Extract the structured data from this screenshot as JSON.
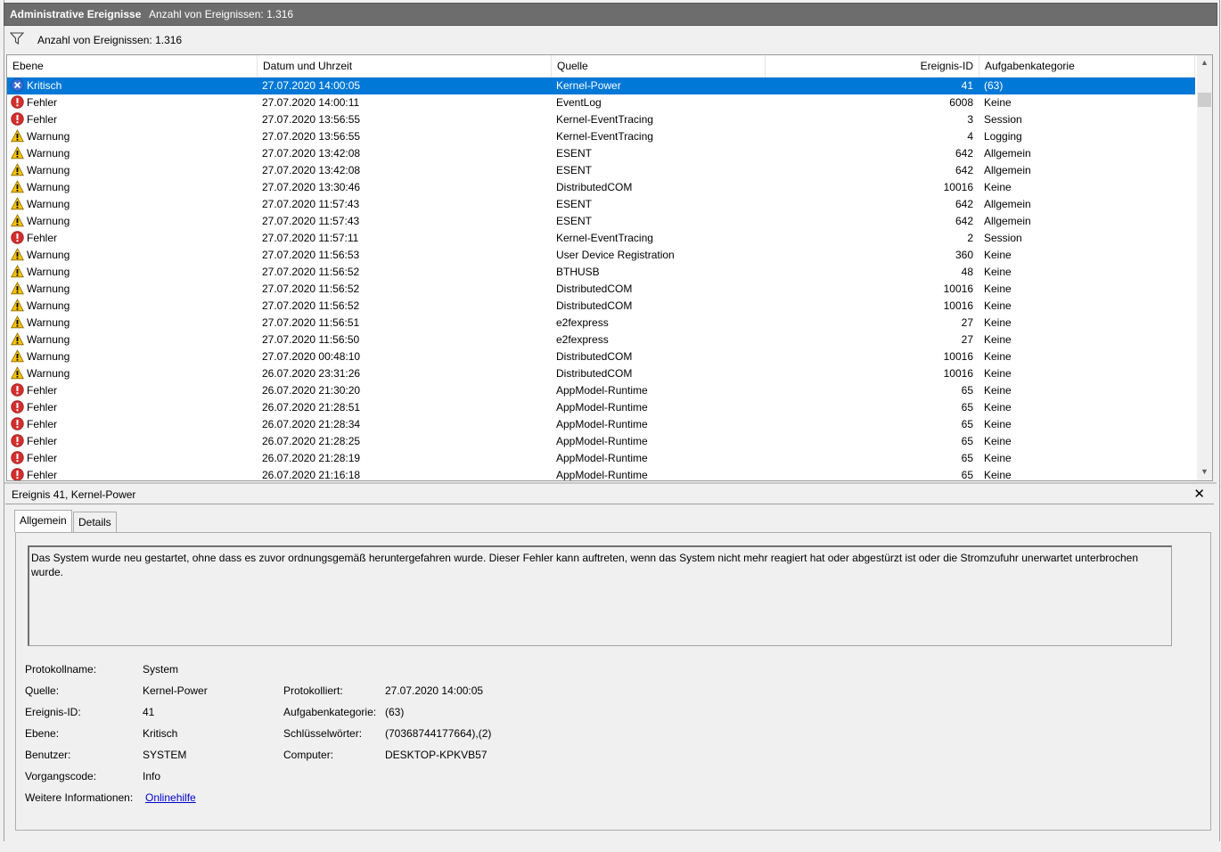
{
  "titlebar": {
    "title": "Administrative Ereignisse",
    "count": "Anzahl von Ereignissen: 1.316"
  },
  "filter": {
    "icon": "filter-icon",
    "text": "Anzahl von Ereignissen: 1.316"
  },
  "columns": {
    "level": "Ebene",
    "date": "Datum und Uhrzeit",
    "source": "Quelle",
    "id": "Ereignis-ID",
    "category": "Aufgabenkategorie"
  },
  "events": [
    {
      "level": "Kritisch",
      "type": "critical",
      "date": "27.07.2020 14:00:05",
      "source": "Kernel-Power",
      "id": "41",
      "category": "(63)"
    },
    {
      "level": "Fehler",
      "type": "error",
      "date": "27.07.2020 14:00:11",
      "source": "EventLog",
      "id": "6008",
      "category": "Keine"
    },
    {
      "level": "Fehler",
      "type": "error",
      "date": "27.07.2020 13:56:55",
      "source": "Kernel-EventTracing",
      "id": "3",
      "category": "Session"
    },
    {
      "level": "Warnung",
      "type": "warning",
      "date": "27.07.2020 13:56:55",
      "source": "Kernel-EventTracing",
      "id": "4",
      "category": "Logging"
    },
    {
      "level": "Warnung",
      "type": "warning",
      "date": "27.07.2020 13:42:08",
      "source": "ESENT",
      "id": "642",
      "category": "Allgemein"
    },
    {
      "level": "Warnung",
      "type": "warning",
      "date": "27.07.2020 13:42:08",
      "source": "ESENT",
      "id": "642",
      "category": "Allgemein"
    },
    {
      "level": "Warnung",
      "type": "warning",
      "date": "27.07.2020 13:30:46",
      "source": "DistributedCOM",
      "id": "10016",
      "category": "Keine"
    },
    {
      "level": "Warnung",
      "type": "warning",
      "date": "27.07.2020 11:57:43",
      "source": "ESENT",
      "id": "642",
      "category": "Allgemein"
    },
    {
      "level": "Warnung",
      "type": "warning",
      "date": "27.07.2020 11:57:43",
      "source": "ESENT",
      "id": "642",
      "category": "Allgemein"
    },
    {
      "level": "Fehler",
      "type": "error",
      "date": "27.07.2020 11:57:11",
      "source": "Kernel-EventTracing",
      "id": "2",
      "category": "Session"
    },
    {
      "level": "Warnung",
      "type": "warning",
      "date": "27.07.2020 11:56:53",
      "source": "User Device Registration",
      "id": "360",
      "category": "Keine"
    },
    {
      "level": "Warnung",
      "type": "warning",
      "date": "27.07.2020 11:56:52",
      "source": "BTHUSB",
      "id": "48",
      "category": "Keine"
    },
    {
      "level": "Warnung",
      "type": "warning",
      "date": "27.07.2020 11:56:52",
      "source": "DistributedCOM",
      "id": "10016",
      "category": "Keine"
    },
    {
      "level": "Warnung",
      "type": "warning",
      "date": "27.07.2020 11:56:52",
      "source": "DistributedCOM",
      "id": "10016",
      "category": "Keine"
    },
    {
      "level": "Warnung",
      "type": "warning",
      "date": "27.07.2020 11:56:51",
      "source": "e2fexpress",
      "id": "27",
      "category": "Keine"
    },
    {
      "level": "Warnung",
      "type": "warning",
      "date": "27.07.2020 11:56:50",
      "source": "e2fexpress",
      "id": "27",
      "category": "Keine"
    },
    {
      "level": "Warnung",
      "type": "warning",
      "date": "27.07.2020 00:48:10",
      "source": "DistributedCOM",
      "id": "10016",
      "category": "Keine"
    },
    {
      "level": "Warnung",
      "type": "warning",
      "date": "26.07.2020 23:31:26",
      "source": "DistributedCOM",
      "id": "10016",
      "category": "Keine"
    },
    {
      "level": "Fehler",
      "type": "error",
      "date": "26.07.2020 21:30:20",
      "source": "AppModel-Runtime",
      "id": "65",
      "category": "Keine"
    },
    {
      "level": "Fehler",
      "type": "error",
      "date": "26.07.2020 21:28:51",
      "source": "AppModel-Runtime",
      "id": "65",
      "category": "Keine"
    },
    {
      "level": "Fehler",
      "type": "error",
      "date": "26.07.2020 21:28:34",
      "source": "AppModel-Runtime",
      "id": "65",
      "category": "Keine"
    },
    {
      "level": "Fehler",
      "type": "error",
      "date": "26.07.2020 21:28:25",
      "source": "AppModel-Runtime",
      "id": "65",
      "category": "Keine"
    },
    {
      "level": "Fehler",
      "type": "error",
      "date": "26.07.2020 21:28:19",
      "source": "AppModel-Runtime",
      "id": "65",
      "category": "Keine"
    },
    {
      "level": "Fehler",
      "type": "error",
      "date": "26.07.2020 21:16:18",
      "source": "AppModel-Runtime",
      "id": "65",
      "category": "Keine"
    }
  ],
  "selected_index": 0,
  "colors": {
    "selection": "#0078d7",
    "error": "#d32f2f",
    "warning": "#f4c20d",
    "critical": "#3b6fd6",
    "link": "#0000cc"
  },
  "detail": {
    "title": "Ereignis 41, Kernel-Power",
    "close": "✕",
    "tabs": {
      "general": "Allgemein",
      "details": "Details"
    },
    "description": "Das System wurde neu gestartet, ohne dass es zuvor ordnungsgemäß heruntergefahren wurde. Dieser Fehler kann auftreten, wenn das System nicht mehr reagiert hat oder abgestürzt ist oder die Stromzufuhr unerwartet unterbrochen wurde.",
    "labels": {
      "logname": "Protokollname:",
      "source": "Quelle:",
      "eventid": "Ereignis-ID:",
      "level": "Ebene:",
      "user": "Benutzer:",
      "opcode": "Vorgangscode:",
      "moreinfo": "Weitere Informationen:",
      "logged": "Protokolliert:",
      "category": "Aufgabenkategorie:",
      "keywords": "Schlüsselwörter:",
      "computer": "Computer:"
    },
    "values": {
      "logname": "System",
      "source": "Kernel-Power",
      "eventid": "41",
      "level": "Kritisch",
      "user": "SYSTEM",
      "opcode": "Info",
      "moreinfo": "Onlinehilfe",
      "logged": "27.07.2020 14:00:05",
      "category": "(63)",
      "keywords": "(70368744177664),(2)",
      "computer": "DESKTOP-KPKVB57"
    }
  }
}
